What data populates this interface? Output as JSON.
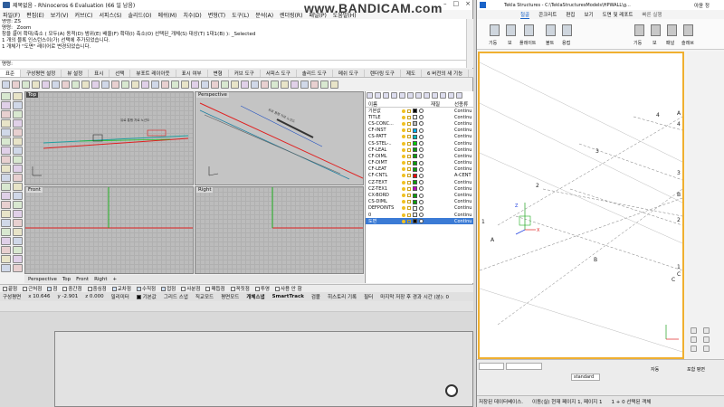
{
  "watermark": "www.BANDICAM.com",
  "rhino": {
    "title": "제목없음 - Rhinoceros 6 Evaluation (66 일 남음)",
    "menu": [
      "파일(F)",
      "편집(E)",
      "보기(V)",
      "커브(C)",
      "서피스(S)",
      "솔리드(O)",
      "메쉬(M)",
      "치수(D)",
      "변형(T)",
      "도구(L)",
      "분석(A)",
      "렌더링(R)",
      "패널(P)",
      "도움말(H)"
    ],
    "command_history": [
      "명령: ZS",
      "명령: _Zoom",
      "창을 끌어 확대/축소 ( 모두(A) 동적(D) 범위(E) 배율(F) 확대(I) 축소(O) 선택된_개체(S) 대상(T) 1대1(B) ): _Selected",
      "1 개의 블록 인스턴스이(가) 선택에 추가되었습니다.",
      "1 개체가 \"도면\" 레이어로 변경되었습니다."
    ],
    "command_prompt": "명령:",
    "tabs": [
      "표준",
      "구성평면 설정",
      "뷰 설정",
      "표시",
      "선택",
      "뷰포트 레이아웃",
      "표시 여부",
      "변형",
      "커브 도구",
      "서피스 도구",
      "솔리드 도구",
      "메쉬 도구",
      "렌더링 도구",
      "제도",
      "6 버전의 새 기능"
    ],
    "viewports": {
      "top": "Top",
      "perspective": "Perspective",
      "front": "Front",
      "right": "Right"
    },
    "viewport_tabs": [
      "Perspective",
      "Top",
      "Front",
      "Right"
    ],
    "layers_header": {
      "name": "이름",
      "material": "재질",
      "linetype": "선종류"
    },
    "layers": [
      {
        "name": "기본값",
        "linetype": "Continu",
        "color": "#000000"
      },
      {
        "name": "TITLE",
        "linetype": "Continu",
        "color": "#ffffff"
      },
      {
        "name": "CS-CONC...",
        "linetype": "Continu",
        "color": "#c0c0c0"
      },
      {
        "name": "CF-INST",
        "linetype": "Continu",
        "color": "#00b0f0"
      },
      {
        "name": "CS-PATT",
        "linetype": "Continu",
        "color": "#00c0c0"
      },
      {
        "name": "CS-STEL-..",
        "linetype": "Continu",
        "color": "#00d000"
      },
      {
        "name": "CF-LEAL",
        "linetype": "Continu",
        "color": "#00a000"
      },
      {
        "name": "CF-DIML",
        "linetype": "Continu",
        "color": "#00a000"
      },
      {
        "name": "CF-DIMT",
        "linetype": "Continu",
        "color": "#00a000"
      },
      {
        "name": "CF-LEAT",
        "linetype": "Continu",
        "color": "#00a000"
      },
      {
        "name": "CF-CNTL",
        "linetype": "A-CENT",
        "color": "#ff0000"
      },
      {
        "name": "CZ-TEXT",
        "linetype": "Continu",
        "color": "#00a000"
      },
      {
        "name": "CZ-TEX1",
        "linetype": "Continu",
        "color": "#c000c0"
      },
      {
        "name": "CX-BORD",
        "linetype": "Continu",
        "color": "#00a000"
      },
      {
        "name": "CS-DIML",
        "linetype": "Continu",
        "color": "#00a000"
      },
      {
        "name": "DEFPOINTS",
        "linetype": "Continu",
        "color": "#ffffff"
      },
      {
        "name": "0",
        "linetype": "Continu",
        "color": "#ffffff"
      },
      {
        "name": "도면",
        "linetype": "Continu",
        "color": "#000000",
        "selected": true
      }
    ],
    "osnap": [
      "끝점",
      "근처점",
      "점",
      "중간점",
      "중심점",
      "교차점",
      "수직점",
      "접점",
      "사분점",
      "매듭점",
      "꼭짓점",
      "투영",
      "사용 안 함"
    ],
    "status": {
      "cplane": "구성평면",
      "x": "x 10.646",
      "y": "y -2.901",
      "z": "z 0.000",
      "units": "밀리미터",
      "layer": "기본값",
      "grid_snap": "그리드 스냅",
      "ortho": "직교모드",
      "planar": "평면모드",
      "osnap": "개체스냅",
      "smarttrack": "SmartTrack",
      "gumball": "검볼",
      "history": "히스토리 기록",
      "filter": "필터",
      "autosave": "마지막 저장 후 경과 시간 (분): 0"
    },
    "top_annotation": "유료 통행 차로 노선도"
  },
  "tekla": {
    "title": "Tekla Structures - C:\\TeklaStructuresModels\\HPWALL\\g...",
    "ribbon_tabs": [
      "철골",
      "콘크리트",
      "편집",
      "보기",
      "도면 및 레포트"
    ],
    "ribbon_labels": [
      "기둥",
      "보",
      "플레이트",
      "볼트",
      "용접",
      "기둥",
      "보",
      "패널",
      "슬래브"
    ],
    "search": "빠른 실행",
    "user": "아윤 정",
    "grid_labels_numbers": [
      "1",
      "2",
      "3",
      "4"
    ],
    "grid_labels_letters": [
      "A",
      "B",
      "C"
    ],
    "bottom": {
      "snap": "standard",
      "mode": "자동",
      "select": "포함 평면"
    },
    "status_left": "저장된 데이터베이스.",
    "status_mid": "이동(실) 현재 페이지 1, 페이지 1",
    "status_right": "1 + 0 선택된 객체"
  }
}
